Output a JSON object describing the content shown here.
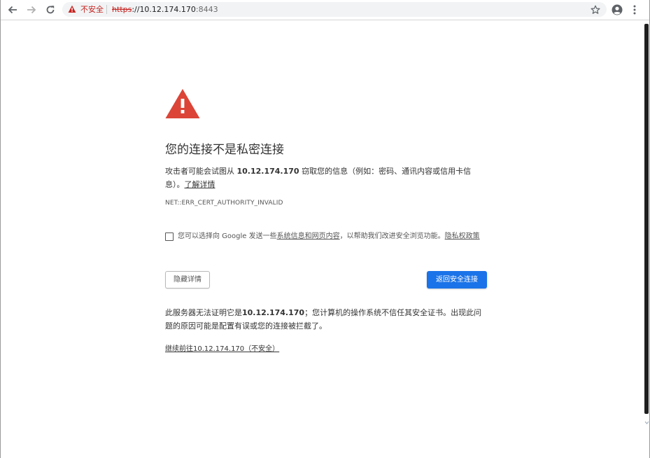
{
  "browser": {
    "omnibox": {
      "security_state": "不安全",
      "url_scheme": "https",
      "url_separator": "://",
      "url_host": "10.12.174.170",
      "url_port": ":8443"
    }
  },
  "interstitial": {
    "heading": "您的连接不是私密连接",
    "message_prefix": "攻击者可能会试图从 ",
    "message_host": "10.12.174.170",
    "message_suffix": " 窃取您的信息（例如：密码、通讯内容或信用卡信息）。",
    "learn_more_link": "了解详情",
    "error_code": "NET::ERR_CERT_AUTHORITY_INVALID",
    "optin": {
      "checked": false,
      "text_prefix": "您可以选择向 Google 发送一些",
      "link_text": "系统信息和网页内容",
      "text_middle": "，以帮助我们改进安全浏览功能。",
      "privacy_link": "隐私权政策"
    },
    "details_button": "隐藏详情",
    "primary_button": "返回安全连接",
    "details_prefix": "此服务器无法证明它是",
    "details_host": "10.12.174.170",
    "details_suffix": "；您计算机的操作系统不信任其安全证书。出现此问题的原因可能是配置有误或您的连接被拦截了。",
    "proceed_link": "继续前往10.12.174.170（不安全）"
  },
  "colors": {
    "danger_red": "#db4437",
    "primary_blue": "#1a73e8",
    "insecure_red": "#c5221f"
  },
  "icons": [
    "back-arrow-icon",
    "forward-arrow-icon",
    "reload-icon",
    "warning-triangle-icon",
    "star-icon",
    "account-icon",
    "kebab-menu-icon",
    "danger-triangle-icon"
  ]
}
